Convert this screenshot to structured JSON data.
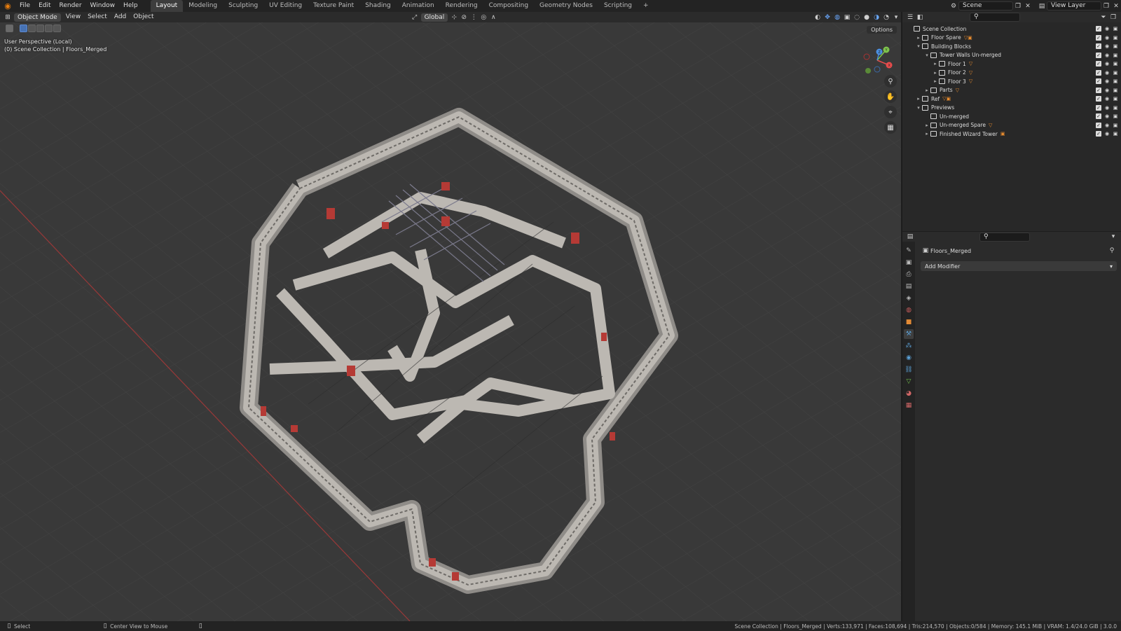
{
  "topbar": {
    "menus": [
      "File",
      "Edit",
      "Render",
      "Window",
      "Help"
    ],
    "workspaces": [
      "Layout",
      "Modeling",
      "Sculpting",
      "UV Editing",
      "Texture Paint",
      "Shading",
      "Animation",
      "Rendering",
      "Compositing",
      "Geometry Nodes",
      "Scripting"
    ],
    "active_workspace": "Layout",
    "add_tab": "+",
    "scene": "Scene",
    "view_layer": "View Layer"
  },
  "viewport": {
    "mode": "Object Mode",
    "menus": [
      "View",
      "Select",
      "Add",
      "Object"
    ],
    "orientation": "Global",
    "options": "Options",
    "perspective": "User Perspective (Local)",
    "collection_path": "(0) Scene Collection | Floors_Merged",
    "gizmo_axes": [
      "X",
      "Y",
      "Z"
    ]
  },
  "outliner": {
    "rows": [
      {
        "label": "Scene Collection",
        "depth": 0,
        "tw": "",
        "objs": ""
      },
      {
        "label": "Floor Spare",
        "depth": 1,
        "tw": "▸",
        "objs": "▽▣"
      },
      {
        "label": "Building Blocks",
        "depth": 1,
        "tw": "▾",
        "objs": ""
      },
      {
        "label": "Tower Walls Un-merged",
        "depth": 2,
        "tw": "▾",
        "objs": ""
      },
      {
        "label": "Floor 1",
        "depth": 3,
        "tw": "▸",
        "objs": "▽"
      },
      {
        "label": "Floor 2",
        "depth": 3,
        "tw": "▸",
        "objs": "▽"
      },
      {
        "label": "Floor 3",
        "depth": 3,
        "tw": "▸",
        "objs": "▽"
      },
      {
        "label": "Parts",
        "depth": 2,
        "tw": "▸",
        "objs": "▽"
      },
      {
        "label": "Ref",
        "depth": 1,
        "tw": "▸",
        "objs": "▽▣"
      },
      {
        "label": "Previews",
        "depth": 1,
        "tw": "▾",
        "objs": ""
      },
      {
        "label": "Un-merged",
        "depth": 2,
        "tw": "",
        "objs": ""
      },
      {
        "label": "Un-merged Spare",
        "depth": 2,
        "tw": "▸",
        "objs": "▽"
      },
      {
        "label": "Finished Wizard Tower",
        "depth": 2,
        "tw": "▸",
        "objs": "▣"
      }
    ]
  },
  "properties": {
    "object_name": "Floors_Merged",
    "add_modifier": "Add Modifier",
    "tab_colors": [
      "#bbbbbb",
      "#bbbbbb",
      "#bbbbbb",
      "#bbbbbb",
      "#bbbbbb",
      "#c95d5d",
      "#e28a35",
      "#5a9fd4",
      "#5a9fd4",
      "#5a9fd4",
      "#5a9fd4",
      "#73c04b",
      "#d06666",
      "#d06666"
    ]
  },
  "statusbar": {
    "left": "Select",
    "middle": "Center View to Mouse",
    "stats": "Scene Collection | Floors_Merged | Verts:133,971 | Faces:108,694 | Tris:214,570 | Objects:0/584 | Memory: 145.1 MiB | VRAM: 1.4/24.0 GiB | 3.0.0"
  }
}
